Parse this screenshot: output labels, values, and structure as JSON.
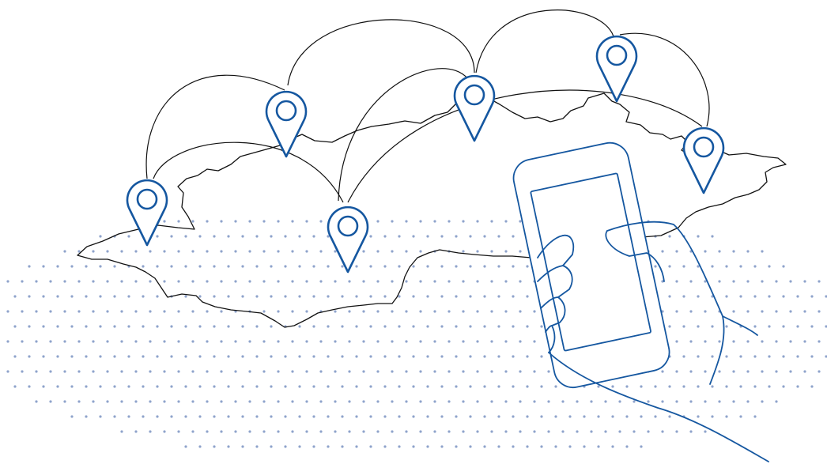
{
  "illustration": {
    "subject": "",
    "colors": {
      "pin_stroke": "#1557a0",
      "map_stroke": "#111111",
      "route_stroke": "#111111",
      "dot_fill": "#8fa3cc",
      "background": "#ffffff"
    },
    "icons": [
      "location-pin-icon",
      "smartphone-icon",
      "hand-icon",
      "map-outline"
    ],
    "pin_count": 6
  }
}
